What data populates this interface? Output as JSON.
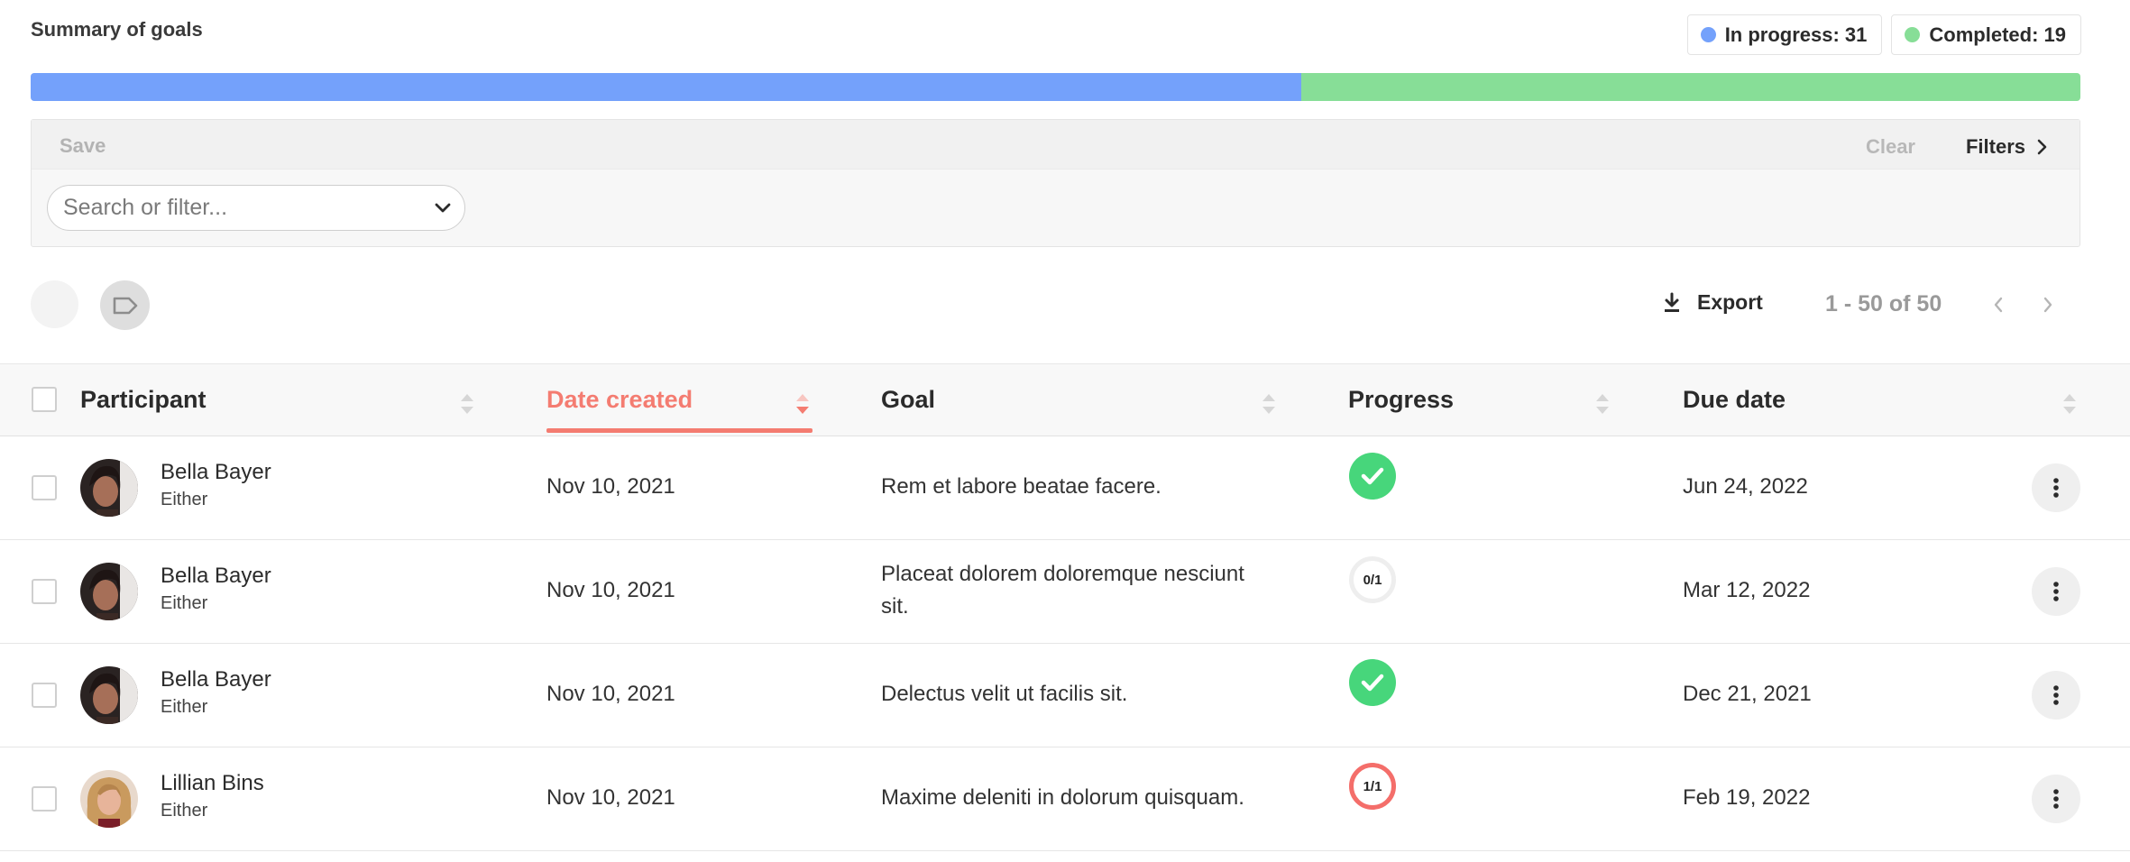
{
  "summary": {
    "title": "Summary of goals",
    "in_progress_label": "In progress: 31",
    "completed_label": "Completed: 19",
    "in_progress_count": 31,
    "completed_count": 19,
    "colors": {
      "in_progress": "#74a1fb",
      "completed": "#87de97"
    }
  },
  "filters": {
    "save_label": "Save",
    "clear_label": "Clear",
    "filters_label": "Filters",
    "search_placeholder": "Search or filter..."
  },
  "toolbar": {
    "export_label": "Export",
    "pagination_text": "1 - 50 of 50"
  },
  "table": {
    "columns": {
      "participant": "Participant",
      "date_created": "Date created",
      "goal": "Goal",
      "progress": "Progress",
      "due_date": "Due date"
    },
    "sorted_by": "date_created",
    "rows": [
      {
        "name": "Bella Bayer",
        "sub": "Either",
        "date": "Nov 10, 2021",
        "goal": "Rem et labore beatae facere.",
        "progress_state": "complete",
        "progress_text": "",
        "due": "Jun 24, 2022"
      },
      {
        "name": "Bella Bayer",
        "sub": "Either",
        "date": "Nov 10, 2021",
        "goal": "Placeat dolorem doloremque nesciunt sit.",
        "progress_state": "pending",
        "progress_text": "0/1",
        "due": "Mar 12, 2022"
      },
      {
        "name": "Bella Bayer",
        "sub": "Either",
        "date": "Nov 10, 2021",
        "goal": "Delectus velit ut facilis sit.",
        "progress_state": "complete",
        "progress_text": "",
        "due": "Dec 21, 2021"
      },
      {
        "name": "Lillian Bins",
        "sub": "Either",
        "date": "Nov 10, 2021",
        "goal": "Maxime deleniti in dolorum quisquam.",
        "progress_state": "overdue",
        "progress_text": "1/1",
        "due": "Feb 19, 2022"
      }
    ]
  },
  "accent_color": "#f47c71"
}
